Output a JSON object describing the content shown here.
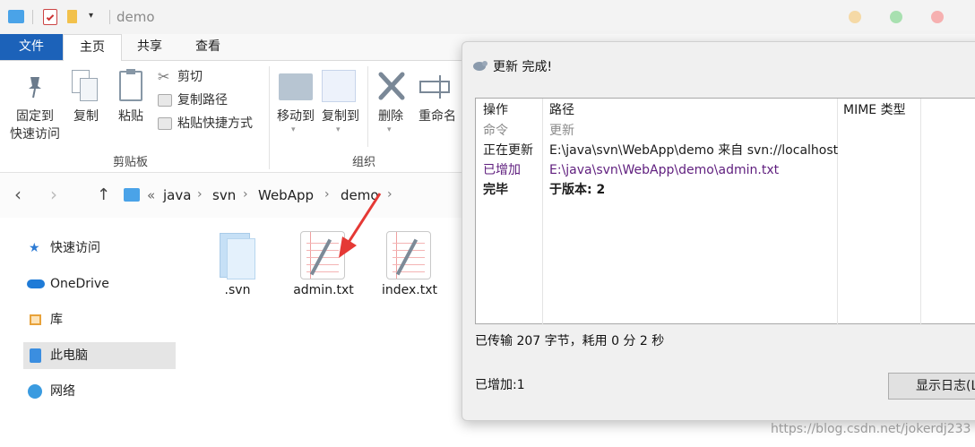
{
  "titlebar": {
    "title": "demo"
  },
  "ribbon_tabs": [
    {
      "label": "文件"
    },
    {
      "label": "主页"
    },
    {
      "label": "共享"
    },
    {
      "label": "查看"
    }
  ],
  "ribbon": {
    "pin_label": "固定到\n快速访问",
    "copy_label": "复制",
    "paste_label": "粘贴",
    "cut_label": "剪切",
    "copy_path_label": "复制路径",
    "paste_shortcut_label": "粘贴快捷方式",
    "clipboard_group": "剪贴板",
    "move_to_label": "移动到",
    "copy_to_label": "复制到",
    "delete_label": "删除",
    "rename_label": "重命名",
    "organize_group": "组织"
  },
  "breadcrumb": {
    "prefix": "«",
    "items": [
      "java",
      "svn",
      "WebApp",
      "demo"
    ]
  },
  "nav": {
    "items": [
      {
        "label": "快速访问",
        "icon": "star-icon"
      },
      {
        "label": "OneDrive",
        "icon": "cloud-icon"
      },
      {
        "label": "库",
        "icon": "library-icon"
      },
      {
        "label": "此电脑",
        "icon": "pc-icon"
      },
      {
        "label": "网络",
        "icon": "network-icon"
      }
    ]
  },
  "files": [
    {
      "name": ".svn",
      "icon": "folder-icon"
    },
    {
      "name": "admin.txt",
      "icon": "text-file-icon"
    },
    {
      "name": "index.txt",
      "icon": "text-file-icon"
    }
  ],
  "dialog": {
    "title": "更新 完成!",
    "columns": [
      "操作",
      "路径",
      "MIME 类型"
    ],
    "rows": [
      {
        "action": "命令",
        "path": "更新"
      },
      {
        "action": "正在更新",
        "path": "E:\\java\\svn\\WebApp\\demo 来自 svn://localhost"
      },
      {
        "action": "已增加",
        "path": "E:\\java\\svn\\WebApp\\demo\\admin.txt"
      },
      {
        "action": "完毕",
        "path": "于版本: 2"
      }
    ],
    "transfer": "已传输 207 字节，耗用 0 分 2 秒",
    "added": "已增加:1",
    "log_button": "显示日志(L)"
  },
  "watermark": "https://blog.csdn.net/jokerdj233",
  "colors": {
    "file_tab": "#1c62b9",
    "added_row": "#5f1e7e",
    "arrow": "#e53935"
  }
}
